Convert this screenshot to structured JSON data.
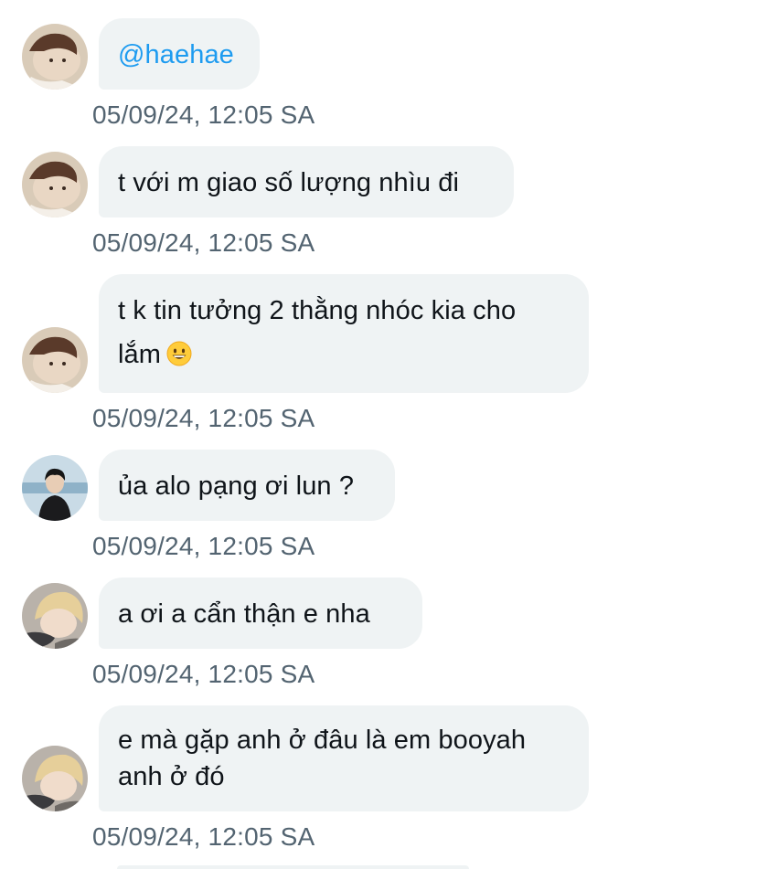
{
  "messages": [
    {
      "avatar": "avatar-user-a",
      "text": "@haehae",
      "timestamp": "05/09/24, 12:05 SA",
      "mention": true
    },
    {
      "avatar": "avatar-user-a",
      "text": "t với m giao số lượng nhìu đi",
      "timestamp": "05/09/24, 12:05 SA"
    },
    {
      "avatar": "avatar-user-a",
      "line1": "t k tin tưởng 2 thằng nhóc kia cho",
      "line2": "lắm",
      "emoji": "grinning-face-emoji",
      "timestamp": "05/09/24, 12:05 SA"
    },
    {
      "avatar": "avatar-user-b",
      "text": "ủa alo pạng ơi lun ?",
      "timestamp": "05/09/24, 12:05 SA"
    },
    {
      "avatar": "avatar-user-c",
      "text": "a ơi a cẩn thận e nha",
      "timestamp": "05/09/24, 12:05 SA"
    },
    {
      "avatar": "avatar-user-c",
      "line1": "e mà gặp anh ở đâu là em booyah",
      "line2": "anh ở đó",
      "timestamp": "05/09/24, 12:05 SA"
    }
  ],
  "colors": {
    "bubble": "#eff3f4",
    "text": "#0f1419",
    "mention": "#1d9bf0",
    "timestamp": "#536471"
  }
}
